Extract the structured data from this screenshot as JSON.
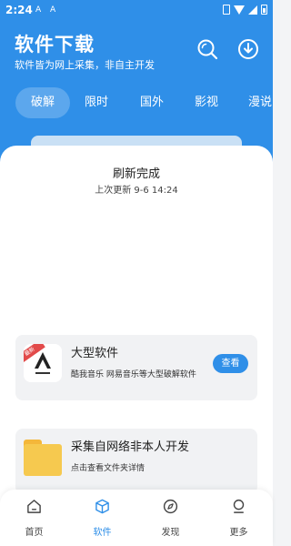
{
  "status_bar": {
    "time": "2:24",
    "icon_1": "A",
    "icon_2": "A"
  },
  "header": {
    "title": "软件下载",
    "subtitle": "软件皆为网上采集，非自主开发",
    "search_icon": "search-icon",
    "download_icon": "download-icon"
  },
  "tabs": [
    {
      "label": "破解",
      "active": true
    },
    {
      "label": "限时",
      "active": false
    },
    {
      "label": "国外",
      "active": false
    },
    {
      "label": "影视",
      "active": false
    },
    {
      "label": "漫说",
      "active": false
    }
  ],
  "refresh": {
    "title": "刷新完成",
    "subtitle": "上次更新 9-6 14:24"
  },
  "cards": [
    {
      "title": "大型软件",
      "description": "酷我音乐 网易音乐等大型破解软件",
      "button": "查看",
      "badge": "最新"
    },
    {
      "title": "采集自网络非本人开发",
      "description": "点击查看文件夹详情"
    }
  ],
  "bottom_nav": [
    {
      "label": "首页",
      "icon": "home-icon",
      "active": false
    },
    {
      "label": "软件",
      "icon": "cube-icon",
      "active": true
    },
    {
      "label": "发现",
      "icon": "compass-icon",
      "active": false
    },
    {
      "label": "更多",
      "icon": "user-icon",
      "active": false
    }
  ],
  "colors": {
    "accent": "#2f8fe8",
    "background": "#f3f4f6",
    "card": "#f1f2f4"
  }
}
